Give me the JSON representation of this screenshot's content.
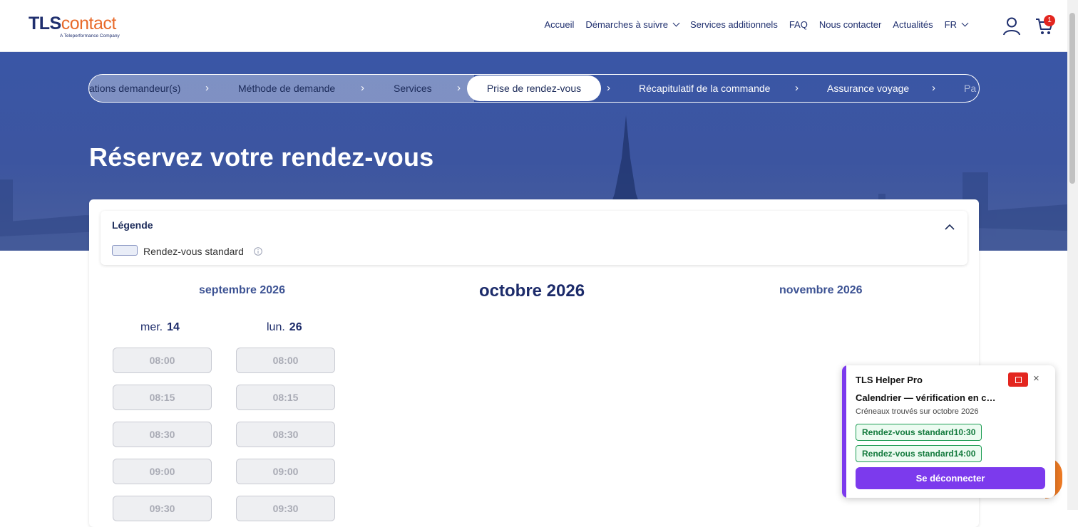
{
  "logo": {
    "brand_bold": "TLS",
    "brand_light": "contact",
    "tagline": "A Teleperformance Company"
  },
  "nav": {
    "items": [
      "Accueil",
      "Démarches à suivre",
      "Services additionnels",
      "FAQ",
      "Nous contacter",
      "Actualités"
    ],
    "language": "FR",
    "cart_count": "1"
  },
  "stepper": {
    "steps": [
      "ations demandeur(s)",
      "Méthode de demande",
      "Services",
      "Prise de rendez-vous",
      "Récapitulatif de la commande",
      "Assurance voyage",
      "Pa"
    ],
    "separator": "›"
  },
  "hero": {
    "title": "Réservez votre rendez-vous"
  },
  "legend": {
    "title": "Légende",
    "items": [
      "Rendez-vous standard"
    ]
  },
  "calendar": {
    "prev_month": "septembre 2026",
    "current_month": "octobre 2026",
    "next_month": "novembre 2026",
    "days": [
      {
        "weekday": "mer.",
        "date": "14",
        "slots": [
          "08:00",
          "08:15",
          "08:30",
          "09:00",
          "09:30"
        ]
      },
      {
        "weekday": "lun.",
        "date": "26",
        "slots": [
          "08:00",
          "08:15",
          "08:30",
          "09:00",
          "09:30"
        ]
      }
    ]
  },
  "helper": {
    "title": "TLS Helper Pro",
    "subtitle": "Calendrier — vérification en cours",
    "note": "Créneaux trouvés sur octobre 2026",
    "found": [
      "Rendez-vous standard10:30",
      "Rendez-vous standard14:00"
    ],
    "logout_label": "Se déconnecter",
    "close_label": "×"
  },
  "colors": {
    "brand_navy": "#1f2f6e",
    "brand_orange": "#e86a2a",
    "helper_accent": "#7c3aed",
    "alert_red": "#e3261f"
  }
}
